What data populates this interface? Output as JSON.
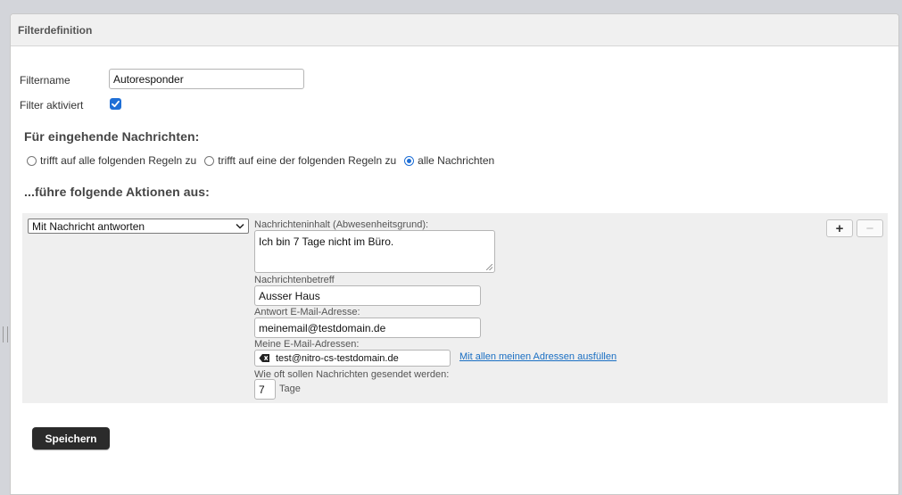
{
  "panel": {
    "title": "Filterdefinition"
  },
  "filter": {
    "name_label": "Filtername",
    "name_value": "Autoresponder",
    "active_label": "Filter aktiviert",
    "active_checked": true
  },
  "incoming": {
    "heading": "Für eingehende Nachrichten:",
    "options": [
      {
        "label": "trifft auf alle folgenden Regeln zu",
        "selected": false
      },
      {
        "label": "trifft auf eine der folgenden Regeln zu",
        "selected": false
      },
      {
        "label": "alle Nachrichten",
        "selected": true
      }
    ]
  },
  "actions": {
    "heading": "...führe folgende Aktionen aus:",
    "action_select": "Mit Nachricht antworten",
    "content_label": "Nachrichteninhalt (Abwesenheitsgrund):",
    "content_value": "Ich bin 7 Tage nicht im Büro.",
    "subject_label": "Nachrichtenbetreff",
    "subject_value": "Ausser Haus",
    "reply_label": "Antwort E-Mail-Adresse:",
    "reply_value": "meinemail@testdomain.de",
    "my_addresses_label": "Meine E-Mail-Adressen:",
    "my_address_value": "test@nitro-cs-testdomain.de",
    "fill_all_link": "Mit allen meinen Adressen ausfüllen",
    "frequency_label": "Wie oft sollen Nachrichten gesendet werden:",
    "frequency_value": "7",
    "frequency_unit": "Tage",
    "add_symbol": "+",
    "remove_symbol": "−"
  },
  "save_label": "Speichern",
  "colors": {
    "accent": "#1f6fd6",
    "link": "#1a6fc3",
    "save_button": "#2b2b2b"
  },
  "icons": [
    "checkmark-icon",
    "chevron-down-icon",
    "remove-tag-icon",
    "plus-icon",
    "minus-icon"
  ]
}
